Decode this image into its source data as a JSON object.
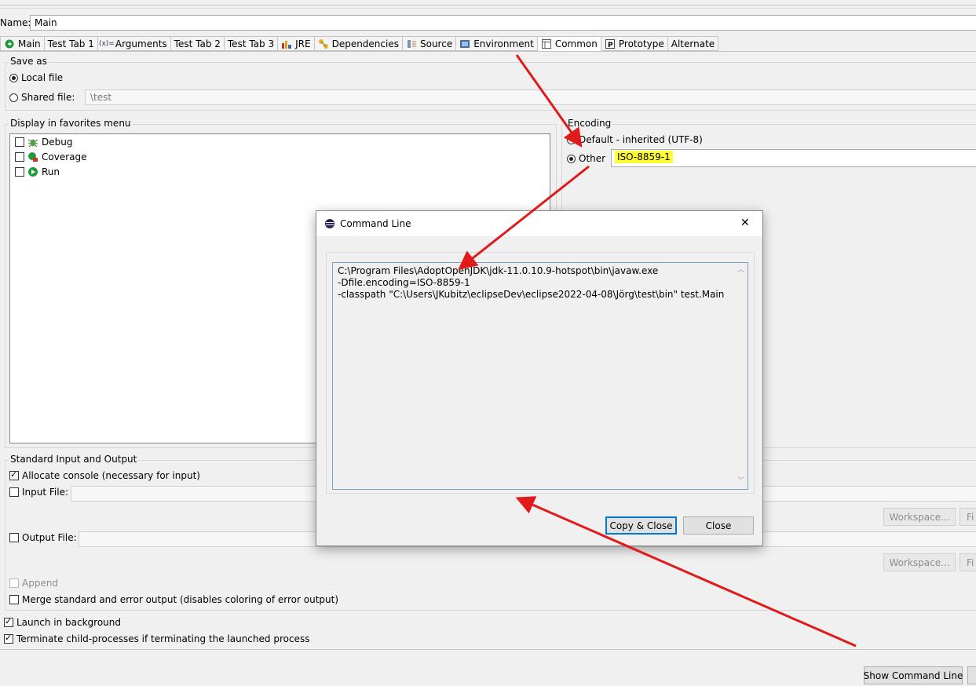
{
  "name_label": "Name:",
  "name_value": "Main",
  "tabs": [
    {
      "label": "Main",
      "icon": "green-circle-icon"
    },
    {
      "label": "Test Tab 1",
      "icon": ""
    },
    {
      "label": "Arguments",
      "icon": "arguments-icon"
    },
    {
      "label": "Test Tab 2",
      "icon": ""
    },
    {
      "label": "Test Tab 3",
      "icon": ""
    },
    {
      "label": "JRE",
      "icon": "jre-icon"
    },
    {
      "label": "Dependencies",
      "icon": "dependencies-icon"
    },
    {
      "label": "Source",
      "icon": "source-icon"
    },
    {
      "label": "Environment",
      "icon": "environment-icon"
    },
    {
      "label": "Common",
      "icon": "common-icon"
    },
    {
      "label": "Prototype",
      "icon": "prototype-icon"
    },
    {
      "label": "Alternate",
      "icon": ""
    }
  ],
  "save_as": {
    "title": "Save as",
    "local_file": "Local file",
    "shared_file": "Shared file:",
    "shared_path": "\\test"
  },
  "favorites": {
    "title": "Display in favorites menu",
    "items": [
      "Debug",
      "Coverage",
      "Run"
    ]
  },
  "encoding": {
    "title": "Encoding",
    "default_option": "Default - inherited (UTF-8)",
    "other_option": "Other",
    "other_value": "ISO-8859-1"
  },
  "std_io": {
    "title": "Standard Input and Output",
    "allocate_console": "Allocate console (necessary for input)",
    "input_file": "Input File:",
    "output_file": "Output File:",
    "workspace": "Workspace...",
    "file_partial": "Fi",
    "append": "Append",
    "merge": "Merge standard and error output (disables coloring of error output)"
  },
  "launch_background": "Launch in background",
  "terminate_children": "Terminate child-processes if terminating the launched process",
  "show_command_line": "Show Command Line",
  "dialog": {
    "title": "Command Line",
    "close_x": "✕",
    "lines": [
      "C:\\Program Files\\AdoptOpenJDK\\jdk-11.0.10.9-hotspot\\bin\\javaw.exe",
      "-Dfile.encoding=ISO-8859-1",
      "-classpath \"C:\\Users\\JKubitz\\eclipseDev\\eclipse2022-04-08\\Jörg\\test\\bin\" test.Main"
    ],
    "copy_close": "Copy & Close",
    "close": "Close"
  },
  "colors": {
    "highlight": "#ffff33",
    "arrow": "#e11b1b",
    "focus_border": "#0078d7"
  }
}
